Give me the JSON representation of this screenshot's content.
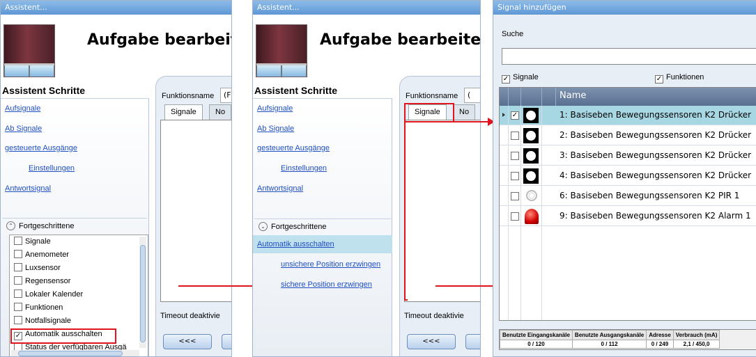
{
  "left_window": {
    "title": "Assistent...",
    "heading": "Aufgabe bearbeiten",
    "steps_heading": "Assistent Schritte",
    "steps": [
      "Aufsignale",
      "Ab Signale",
      "gesteuerte Ausgänge",
      "Einstellungen",
      "Antwortsignal"
    ],
    "advanced_label": "Fortgeschrittene",
    "advanced_items": [
      {
        "label": "Signale",
        "checked": false
      },
      {
        "label": "Anemometer",
        "checked": false
      },
      {
        "label": "Luxsensor",
        "checked": false
      },
      {
        "label": "Regensensor",
        "checked": false
      },
      {
        "label": "Lokaler Kalender",
        "checked": false
      },
      {
        "label": "Funktionen",
        "checked": false
      },
      {
        "label": "Notfallsignale",
        "checked": false
      },
      {
        "label": "Automatik ausschalten",
        "checked": true
      },
      {
        "label": "Status der verfügbaren Ausgä",
        "checked": false
      }
    ],
    "function_name_label": "Funktionsname",
    "function_name_value": "(F",
    "tabs": [
      "Signale",
      "No"
    ],
    "timeout_label": "Timeout deaktivie",
    "back_button": "<<<"
  },
  "middle_window": {
    "title": "Assistent...",
    "heading": "Aufgabe bearbeiten",
    "steps_heading": "Assistent Schritte",
    "steps": [
      "Aufsignale",
      "Ab Signale",
      "gesteuerte Ausgänge",
      "Einstellungen",
      "Antwortsignal"
    ],
    "advanced_label": "Fortgeschrittene",
    "advanced_steps": [
      "Automatik ausschalten",
      "unsichere Position erzwingen",
      "sichere Position erzwingen"
    ],
    "function_name_label": "Funktionsname",
    "function_name_value": "(",
    "tabs": [
      "Signale",
      "No"
    ],
    "timeout_label": "Timeout deaktivie",
    "back_button": "<<<"
  },
  "right_window": {
    "title": "Signal hinzufügen",
    "search_label": "Suche",
    "search_value": "",
    "filter_signals": "Signale",
    "filter_functions": "Funktionen",
    "column_name": "Name",
    "rows": [
      {
        "text": "1: Basiseben Bewegungssensoren K2 Drücker",
        "checked": true,
        "icon": "push-button-icon",
        "selected": true
      },
      {
        "text": "2: Basiseben Bewegungssensoren K2 Drücker",
        "checked": false,
        "icon": "push-button-icon",
        "selected": false
      },
      {
        "text": "3: Basiseben Bewegungssensoren K2 Drücker",
        "checked": false,
        "icon": "push-button-icon",
        "selected": false
      },
      {
        "text": "4: Basiseben Bewegungssensoren K2 Drücker",
        "checked": false,
        "icon": "push-button-icon",
        "selected": false
      },
      {
        "text": "6: Basiseben Bewegungssensoren K2 PIR 1",
        "checked": false,
        "icon": "pir-sensor-icon",
        "selected": false
      },
      {
        "text": "9: Basiseben Bewegungssensoren K2 Alarm 1",
        "checked": false,
        "icon": "alarm-icon",
        "selected": false
      }
    ],
    "stats_headers": [
      "Benutzte Eingangskanäle",
      "Benutzte Ausgangskanäle",
      "Adresse",
      "Verbrauch (mA)"
    ],
    "stats_values": [
      "0 / 120",
      "0 / 112",
      "0 / 249",
      "2,1 / 450,0"
    ]
  },
  "colors": {
    "title_bar": "#5f98d6",
    "link": "#1f4fc2",
    "highlight": "#bfe1ee",
    "annotation_red": "#e0141c",
    "grid_header": "#5a7092"
  }
}
